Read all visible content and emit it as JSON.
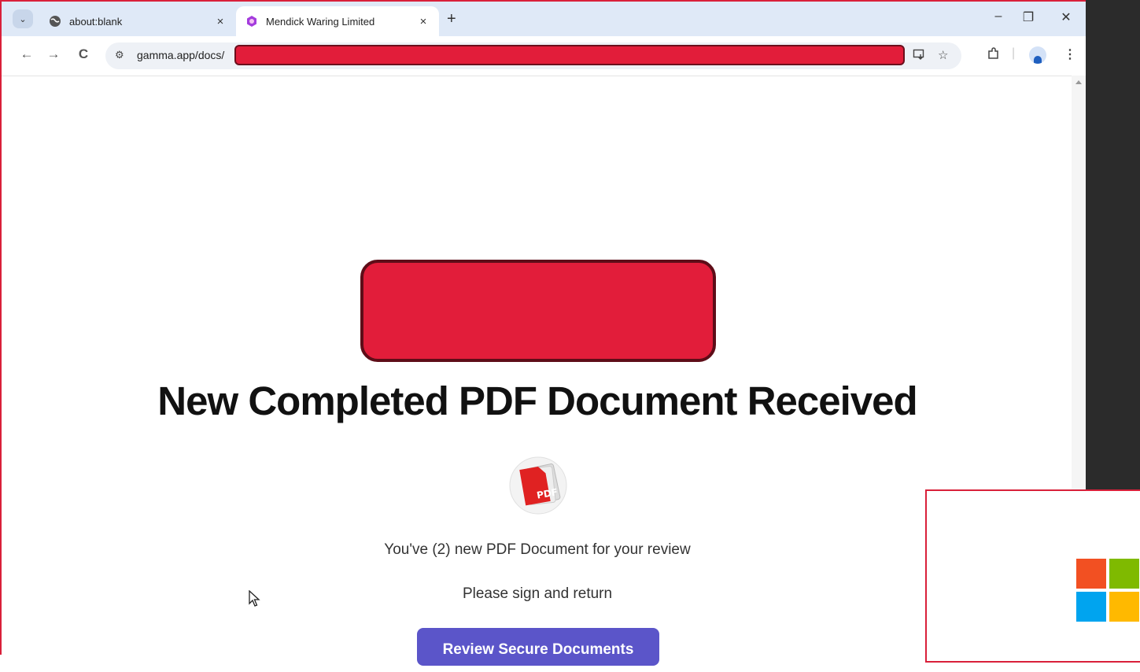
{
  "browser": {
    "tab_search_icon": "chevron-down-icon",
    "tabs": [
      {
        "title": "about:blank",
        "icon": "globe-icon",
        "active": false
      },
      {
        "title": "Mendick Waring Limited",
        "icon": "gamma-icon",
        "active": true
      }
    ],
    "new_tab_icon": "plus-icon",
    "close_glyph": "×",
    "window_controls": {
      "minimize": "–",
      "restore": "❐",
      "close": "✕"
    },
    "nav": {
      "back": "←",
      "forward": "→",
      "reload": "C"
    },
    "url_prefix": "gamma.app/docs/",
    "site_info_icon": "tune-icon",
    "omnibox_icons": [
      "install-icon",
      "star-icon"
    ],
    "toolbar_icons": [
      "extensions-icon",
      "profile-icon",
      "menu-icon"
    ]
  },
  "page": {
    "headline": "New Completed PDF Document Received",
    "pdf_label": "PDF",
    "message_1": "You've (2) new PDF Document for your review",
    "message_2": "Please sign and return",
    "cta_label": "Review Secure Documents"
  },
  "colors": {
    "redaction": "#e21d3a",
    "cta": "#5b55c9",
    "tabstrip": "#dfe9f7",
    "ms_red": "#f25022",
    "ms_green": "#7fba00",
    "ms_blue": "#00a4ef",
    "ms_yellow": "#ffb900"
  }
}
